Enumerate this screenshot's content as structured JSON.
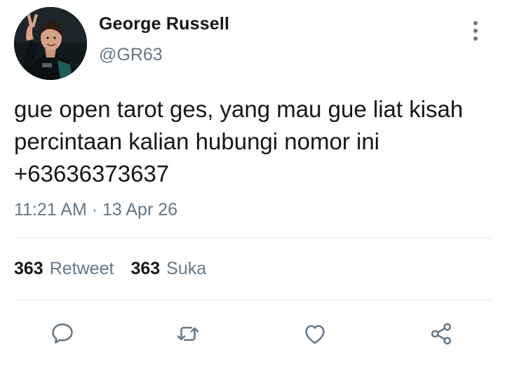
{
  "tweet": {
    "author": {
      "display_name": "George Russell",
      "handle": "@GR63",
      "avatar_icon": "profile-photo"
    },
    "text_lines": [
      "gue open tarot ges, yang mau gue liat kisah",
      "percintaan kalian hubungi nomor ini",
      "+63636373637"
    ],
    "timestamp": "11:21 AM · 13 Apr 26",
    "stats": {
      "retweets": {
        "count": "363",
        "label": "Retweet"
      },
      "likes": {
        "count": "363",
        "label": "Suka"
      }
    },
    "actions": [
      {
        "name": "reply",
        "icon": "speech-bubble-icon"
      },
      {
        "name": "retweet",
        "icon": "retweet-icon"
      },
      {
        "name": "like",
        "icon": "heart-icon"
      },
      {
        "name": "share",
        "icon": "share-icon"
      }
    ],
    "menu_icon": "vertical-dots-icon"
  },
  "colors": {
    "text_primary": "#14171a",
    "text_secondary": "#657786",
    "divider": "#e1e8ed",
    "icon": "#657786"
  }
}
